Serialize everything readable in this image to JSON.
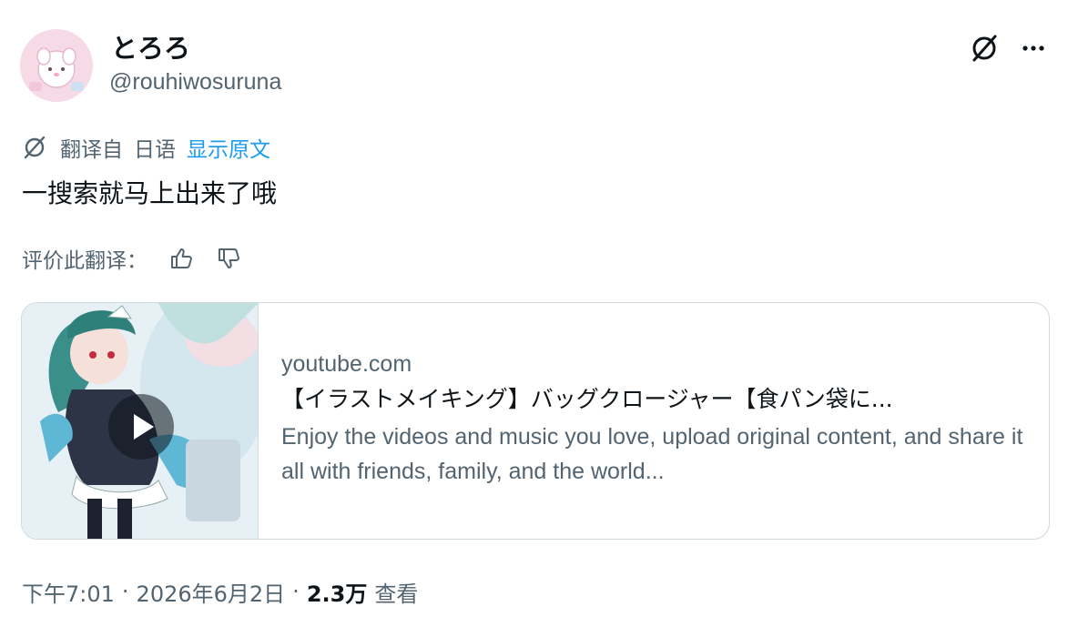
{
  "author": {
    "display_name": "とろろ",
    "handle": "@rouhiwosuruna"
  },
  "header_icons": [
    "grok-icon",
    "more-options-icon"
  ],
  "translation": {
    "prefix": "翻译自",
    "source_language": "日语",
    "show_original_label": "显示原文"
  },
  "tweet": {
    "text": "一搜索就马上出来了哦"
  },
  "rate_translation": {
    "label": "评价此翻译："
  },
  "link_card": {
    "domain": "youtube.com",
    "title": "【イラストメイキング】バッグクロージャー【食パン袋に...",
    "description": "Enjoy the videos and music you love, upload original content, and share it all with friends, family, and the world..."
  },
  "meta": {
    "time": "下午7:01",
    "separator": "·",
    "date": "2026年6月2日",
    "views_count": "2.3万",
    "views_label": "查看"
  },
  "colors": {
    "link_blue": "#1d9bf0",
    "secondary_text": "#536471",
    "border": "#cfd9de"
  }
}
